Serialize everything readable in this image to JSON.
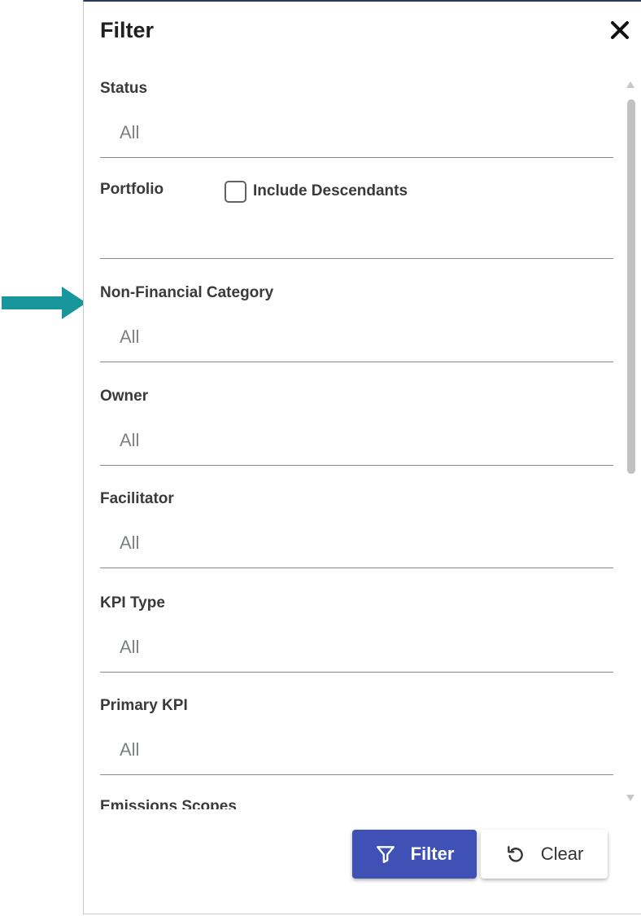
{
  "panel": {
    "title": "Filter",
    "close_icon": "close-icon"
  },
  "fields": {
    "status": {
      "label": "Status",
      "value": "All"
    },
    "portfolio": {
      "label": "Portfolio",
      "value": "",
      "include_descendants_label": "Include Descendants",
      "include_descendants_checked": false
    },
    "non_financial_category": {
      "label": "Non-Financial Category",
      "value": "All"
    },
    "owner": {
      "label": "Owner",
      "value": "All"
    },
    "facilitator": {
      "label": "Facilitator",
      "value": "All"
    },
    "kpi_type": {
      "label": "KPI Type",
      "value": "All"
    },
    "primary_kpi": {
      "label": "Primary KPI",
      "value": "All"
    },
    "emissions_scopes": {
      "label": "Emissions Scopes"
    }
  },
  "buttons": {
    "filter_label": "Filter",
    "filter_icon": "funnel-icon",
    "clear_label": "Clear",
    "clear_icon": "undo-icon"
  },
  "annotation": {
    "arrow_icon": "arrow-right-icon",
    "arrow_color": "#17979c"
  },
  "colors": {
    "primary": "#3f51b5",
    "label": "#3a3a3a",
    "value": "#7d8186"
  }
}
